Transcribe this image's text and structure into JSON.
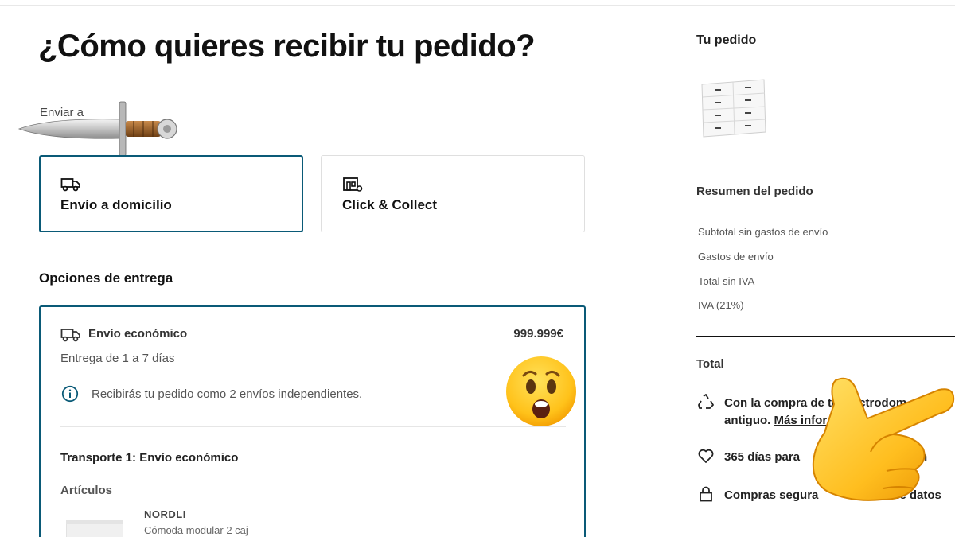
{
  "page": {
    "title": "¿Cómo quieres recibir tu pedido?",
    "ship_to_label": "Enviar a"
  },
  "delivery_modes": [
    {
      "label": "Envío a domicilio",
      "icon": "truck-icon",
      "selected": true
    },
    {
      "label": "Click & Collect",
      "icon": "store-icon",
      "selected": false
    }
  ],
  "delivery_options": {
    "heading": "Opciones de entrega",
    "option": {
      "name": "Envío económico",
      "price": "999.999€",
      "eta": "Entrega de 1 a 7 días",
      "info": "Recibirás tu pedido como 2 envíos independientes.",
      "transport_title": "Transporte 1: Envío económico",
      "articles_heading": "Artículos",
      "product_name": "NORDLI",
      "product_desc": "Cómoda modular 2 caj"
    }
  },
  "order_summary": {
    "title": "Tu pedido",
    "heading": "Resumen del pedido",
    "lines": [
      "Subtotal sin gastos de envío",
      "Gastos de envío",
      "Total sin IVA",
      "IVA (21%)"
    ],
    "total_label": "Total",
    "perks": [
      {
        "icon": "recycle-icon",
        "line1": "Con la compra de tu electrodom",
        "line2_prefix": "antiguo. ",
        "link": "Más inforr"
      },
      {
        "icon": "heart-icon",
        "text": "365 días para",
        "suffix": "n"
      },
      {
        "icon": "lock-icon",
        "text": "Compras segura",
        "suffix": "cifrado de datos"
      }
    ]
  },
  "colors": {
    "accent": "#0a5a77",
    "text": "#111111",
    "muted": "#555555",
    "border": "#dfdfdf"
  }
}
